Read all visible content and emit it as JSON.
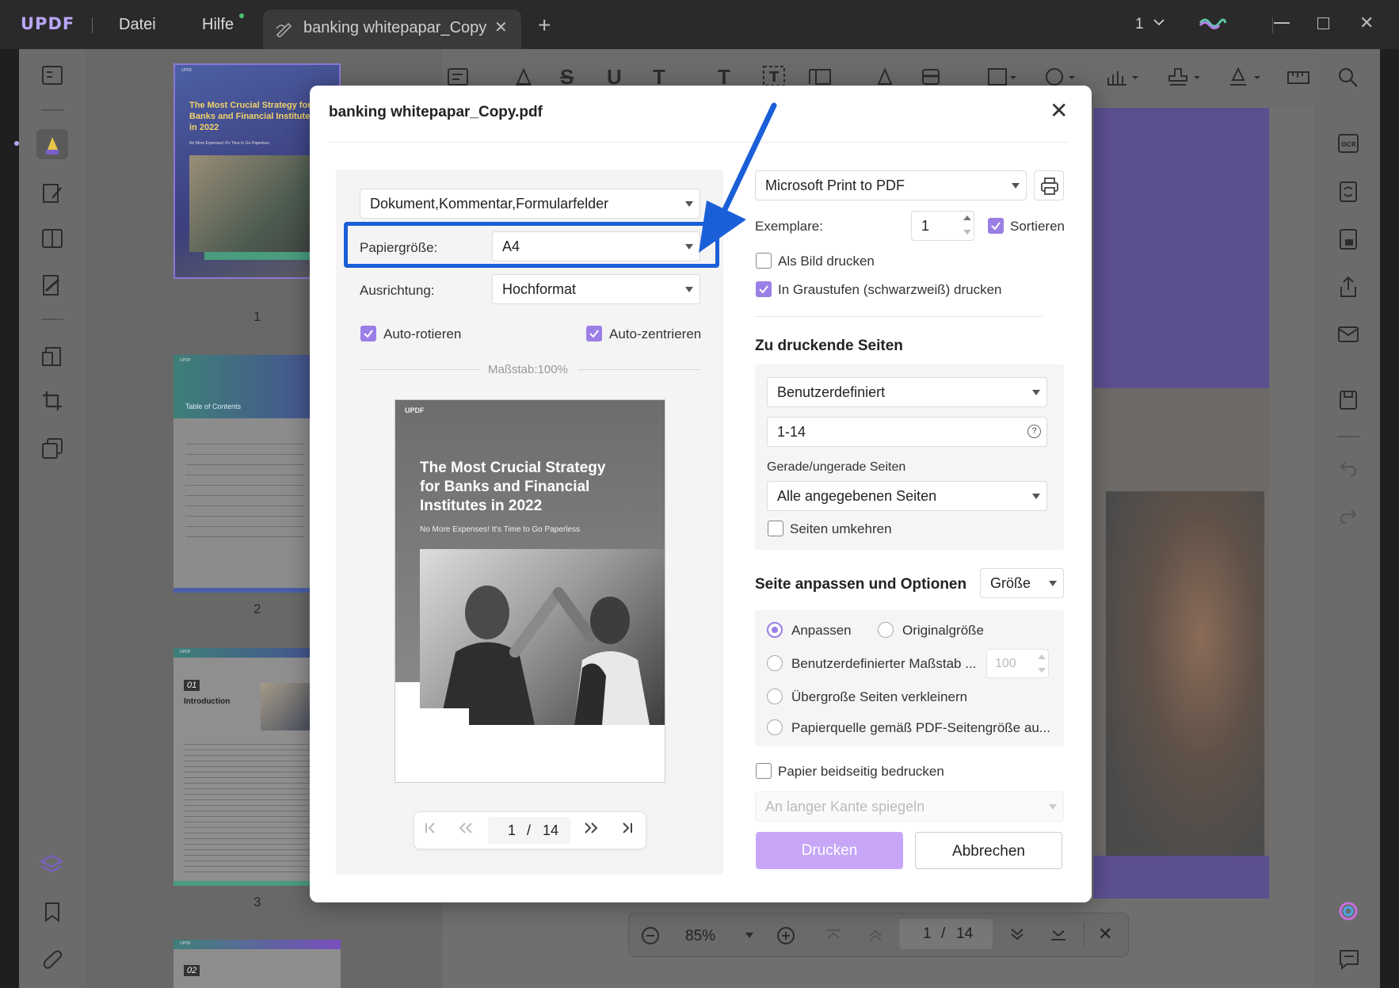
{
  "app": {
    "logo": "UPDF",
    "menu_file": "Datei",
    "menu_help": "Hilfe",
    "tab_title": "banking whitepapar_Copy",
    "page_indicator": "1"
  },
  "thumbnails": {
    "labels": [
      "1",
      "2",
      "3"
    ],
    "page1": {
      "logo": "UPDF",
      "title": "The Most Crucial Strategy for Banks and Financial Institutes in 2022",
      "subtitle": "No More Expenses! It's Time to Go Paperless"
    },
    "page2": {
      "logo": "UPDF",
      "title": "Table of Contents"
    },
    "page3": {
      "logo": "UPDF",
      "chapter": "01",
      "heading": "Introduction"
    },
    "page4": {
      "logo": "UPDF",
      "chapter": "02"
    }
  },
  "zoom_bar": {
    "zoom": "85%",
    "current_page": "1",
    "separator": "/",
    "total_pages": "14"
  },
  "dialog": {
    "title": "banking whitepapar_Copy.pdf",
    "left": {
      "content_select": "Dokument,Kommentar,Formularfelder",
      "paper_size_label": "Papiergröße:",
      "paper_size_value": "A4",
      "orientation_label": "Ausrichtung:",
      "orientation_value": "Hochformat",
      "auto_rotate": "Auto-rotieren",
      "auto_center": "Auto-zentrieren",
      "scale": "Maßstab:100%",
      "preview": {
        "logo": "UPDF",
        "title": "The Most Crucial Strategy for Banks and Financial Institutes in 2022",
        "subtitle": "No More Expenses! It's Time to Go Paperless"
      },
      "pager": {
        "current": "1",
        "separator": "/",
        "total": "14"
      }
    },
    "right": {
      "printer": "Microsoft Print to PDF",
      "copies_label": "Exemplare:",
      "copies_value": "1",
      "collate": "Sortieren",
      "print_as_image": "Als Bild drucken",
      "grayscale": "In Graustufen (schwarzweiß) drucken",
      "pages_title": "Zu druckende Seiten",
      "page_range_mode": "Benutzerdefiniert",
      "page_range": "1-14",
      "odd_even_label": "Gerade/ungerade Seiten",
      "odd_even_value": "Alle angegebenen Seiten",
      "reverse": "Seiten umkehren",
      "fit_title": "Seite anpassen und Optionen",
      "fit_mode": "Größe",
      "opt_fit": "Anpassen",
      "opt_original": "Originalgröße",
      "opt_custom_scale": "Benutzerdefinierter Maßstab ...",
      "custom_scale_value": "100",
      "opt_shrink": "Übergroße Seiten verkleinern",
      "opt_paper_source": "Papierquelle gemäß PDF-Seitengröße au...",
      "duplex": "Papier beidseitig bedrucken",
      "duplex_mode": "An langer Kante spiegeln",
      "print_button": "Drucken",
      "cancel_button": "Abbrechen"
    }
  },
  "colors": {
    "accent": "#9b7fe6",
    "highlight": "#1a5fd8",
    "print_button": "#c7a6f7"
  }
}
